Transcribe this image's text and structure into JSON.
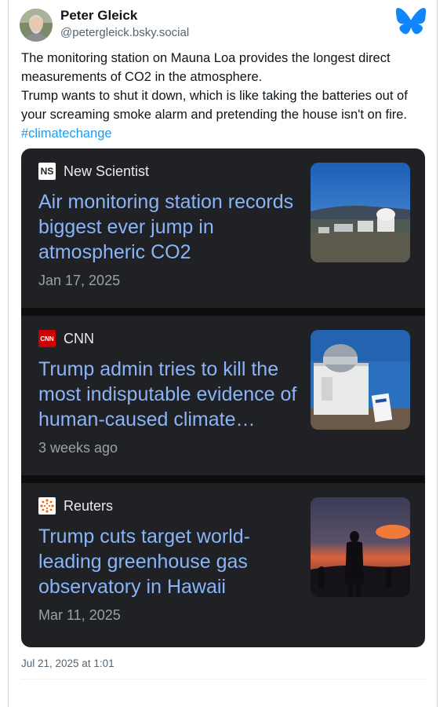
{
  "author": {
    "name": "Peter Gleick",
    "handle": "@petergleick.bsky.social"
  },
  "post": {
    "line1": "The monitoring station on Mauna Loa provides the longest direct measurements of CO2 in the atmosphere.",
    "line2": "Trump wants to shut it down, which is like taking the batteries out of your screaming smoke alarm and pretending the house isn't on fire.",
    "hashtag": "#climatechange"
  },
  "news": [
    {
      "source": "New Scientist",
      "source_icon": "NS",
      "headline": "Air monitoring station records biggest ever jump in atmospheric CO2",
      "date": "Jan 17, 2025"
    },
    {
      "source": "CNN",
      "source_icon": "CNN",
      "headline": "Trump admin tries to kill the most indisputable evidence of human-caused climate…",
      "date": "3 weeks ago"
    },
    {
      "source": "Reuters",
      "source_icon": "reuters-logo",
      "headline": "Trump cuts target world-leading greenhouse gas observatory in Hawaii",
      "date": "Mar 11, 2025"
    }
  ],
  "timestamp": "Jul 21, 2025 at 1:01",
  "colors": {
    "brand_blue": "#1185fe",
    "link_blue": "#1d9bf0",
    "card_bg": "#202124",
    "headline_blue": "#8ab4f8",
    "cnn_red": "#cc0000"
  }
}
